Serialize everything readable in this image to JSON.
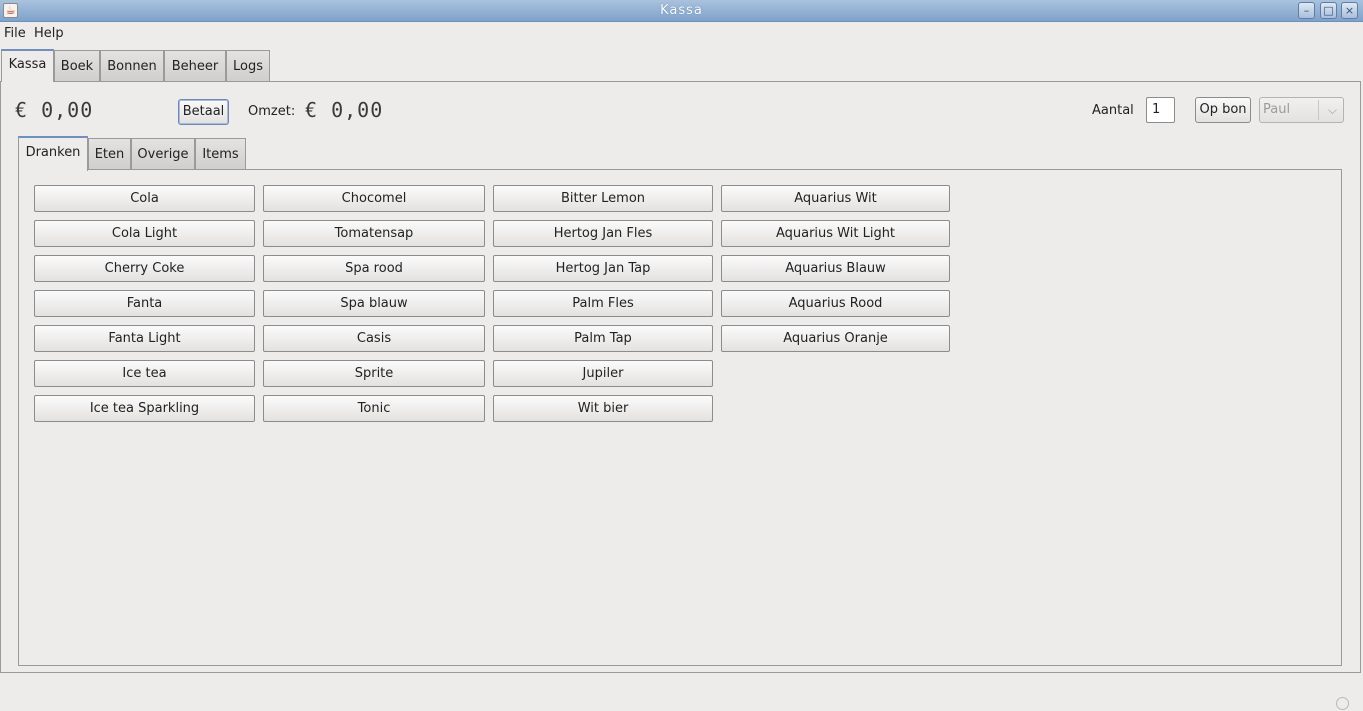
{
  "window": {
    "title": "Kassa",
    "icon_glyph": "☕"
  },
  "window_controls": {
    "minimize": "–",
    "maximize": "□",
    "close": "×"
  },
  "menu": [
    "File",
    "Help"
  ],
  "main_tabs": [
    "Kassa",
    "Boek",
    "Bonnen",
    "Beheer",
    "Logs"
  ],
  "kassa": {
    "amount": "€ 0,00",
    "pay_label": "Betaal",
    "omzet_label": "Omzet:",
    "omzet_amount": "€ 0,00",
    "aantal_label": "Aantal",
    "aantal_value": "1",
    "op_bon_label": "Op bon",
    "user_select": "Paul"
  },
  "sub_tabs": [
    "Dranken",
    "Eten",
    "Overige",
    "Items"
  ],
  "drinks": [
    [
      "Cola",
      "Cola Light",
      "Cherry Coke",
      "Fanta",
      "Fanta Light",
      "Ice tea",
      "Ice tea Sparkling"
    ],
    [
      "Chocomel",
      "Tomatensap",
      "Spa rood",
      "Spa blauw",
      "Casis",
      "Sprite",
      "Tonic"
    ],
    [
      "Bitter Lemon",
      "Hertog Jan Fles",
      "Hertog Jan Tap",
      "Palm Fles",
      "Palm Tap",
      "Jupiler",
      "Wit bier"
    ],
    [
      "Aquarius Wit",
      "Aquarius Wit Light",
      "Aquarius Blauw",
      "Aquarius Rood",
      "Aquarius Oranje"
    ]
  ],
  "colors": {
    "titlebar": "#8fadd3",
    "active_tab_accent": "#6f8fbf",
    "background": "#edeceb"
  }
}
